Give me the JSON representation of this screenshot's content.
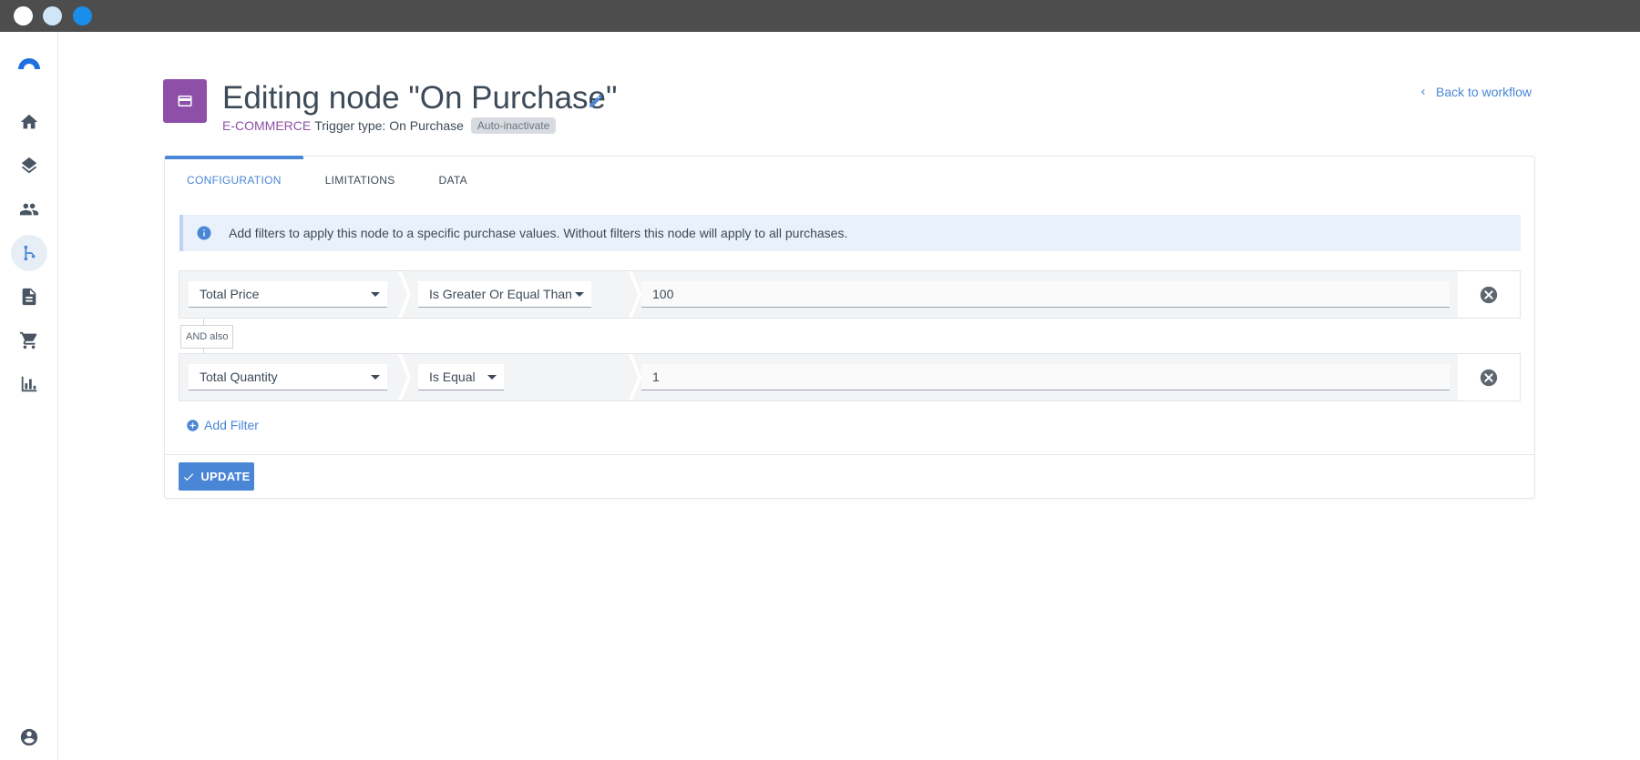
{
  "window": {
    "controls": [
      "close",
      "minimize",
      "maximize"
    ]
  },
  "sidebar": {
    "logo_icon": "app-logo-icon",
    "items": [
      {
        "name": "home",
        "icon": "home-icon",
        "active": false
      },
      {
        "name": "layers",
        "icon": "layers-icon",
        "active": false
      },
      {
        "name": "contacts",
        "icon": "people-icon",
        "active": false
      },
      {
        "name": "workflows",
        "icon": "workflow-icon",
        "active": true
      },
      {
        "name": "documents",
        "icon": "document-icon",
        "active": false
      },
      {
        "name": "ecommerce",
        "icon": "cart-icon",
        "active": false
      },
      {
        "name": "reports",
        "icon": "bar-chart-icon",
        "active": false
      }
    ],
    "profile_icon": "account-icon"
  },
  "header": {
    "title": "Editing node \"On Purchase\"",
    "category": "E-COMMERCE",
    "trigger_type": "Trigger type: On Purchase",
    "badge": "Auto-inactivate",
    "back_link": "Back to workflow",
    "node_icon": "credit-card-icon",
    "accent_color": "#8e4fa8"
  },
  "tabs": [
    {
      "label": "CONFIGURATION",
      "active": true
    },
    {
      "label": "LIMITATIONS",
      "active": false
    },
    {
      "label": "DATA",
      "active": false
    }
  ],
  "info": {
    "text": "Add filters to apply this node to a specific purchase values. Without filters this node will apply to all purchases."
  },
  "filters": [
    {
      "field": "Total Price",
      "operator": "Is Greater Or Equal Than",
      "value": "100"
    },
    {
      "field": "Total Quantity",
      "operator": "Is Equal",
      "value": "1"
    }
  ],
  "connector_label": "AND also",
  "add_filter_label": "Add Filter",
  "update_label": "UPDATE",
  "primary_color": "#4a86d6"
}
